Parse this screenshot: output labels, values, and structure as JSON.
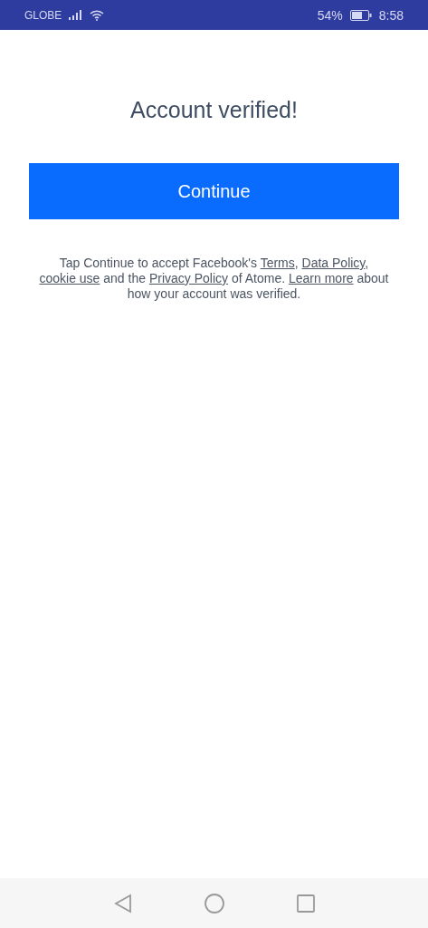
{
  "status_bar": {
    "carrier": "GLOBE",
    "battery_percent": "54%",
    "time": "8:58"
  },
  "title": "Account verified!",
  "continue_button": {
    "label": "Continue"
  },
  "notice": [
    {
      "kind": "text",
      "text": "Tap Continue to accept Facebook's "
    },
    {
      "kind": "link",
      "text": "Terms"
    },
    {
      "kind": "text",
      "text": ", "
    },
    {
      "kind": "link",
      "text": "Data Policy"
    },
    {
      "kind": "text",
      "text": ", "
    },
    {
      "kind": "link",
      "text": "cookie use"
    },
    {
      "kind": "text",
      "text": " and the "
    },
    {
      "kind": "link",
      "text": "Privacy Policy"
    },
    {
      "kind": "text",
      "text": " of Atome. "
    },
    {
      "kind": "link",
      "text": "Learn more"
    },
    {
      "kind": "text",
      "text": " about how your account was verified."
    }
  ]
}
